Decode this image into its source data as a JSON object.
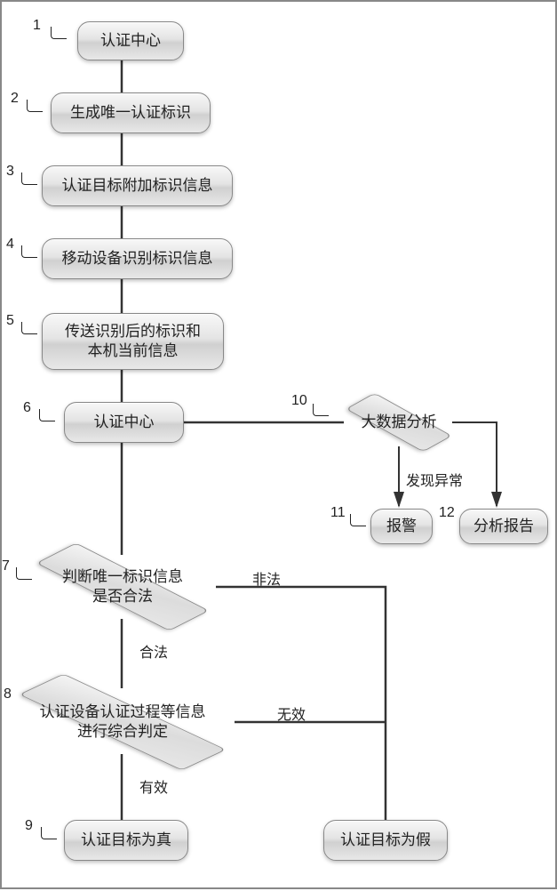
{
  "nodes": {
    "n1": "认证中心",
    "n2": "生成唯一认证标识",
    "n3": "认证目标附加标识信息",
    "n4": "移动设备识别标识信息",
    "n5": "传送识别后的标识和\n本机当前信息",
    "n6": "认证中心",
    "n7": "判断唯一标识信息\n是否合法",
    "n8": "认证设备认证过程等信息\n进行综合判定",
    "n9": "认证目标为真",
    "n10": "大数据分析",
    "n11": "报警",
    "n12": "分析报告",
    "nfalse": "认证目标为假"
  },
  "labels": {
    "l1": "1",
    "l2": "2",
    "l3": "3",
    "l4": "4",
    "l5": "5",
    "l6": "6",
    "l7": "7",
    "l8": "8",
    "l9": "9",
    "l10": "10",
    "l11": "11",
    "l12": "12"
  },
  "edge_labels": {
    "legal": "合法",
    "illegal": "非法",
    "valid": "有效",
    "invalid": "无效",
    "anomaly": "发现异常"
  },
  "chart_data": {
    "type": "flowchart",
    "nodes": [
      {
        "id": 1,
        "label": "认证中心",
        "shape": "rounded-rect"
      },
      {
        "id": 2,
        "label": "生成唯一认证标识",
        "shape": "rounded-rect"
      },
      {
        "id": 3,
        "label": "认证目标附加标识信息",
        "shape": "rounded-rect"
      },
      {
        "id": 4,
        "label": "移动设备识别标识信息",
        "shape": "rounded-rect"
      },
      {
        "id": 5,
        "label": "传送识别后的标识和本机当前信息",
        "shape": "rounded-rect"
      },
      {
        "id": 6,
        "label": "认证中心",
        "shape": "rounded-rect"
      },
      {
        "id": 7,
        "label": "判断唯一标识信息是否合法",
        "shape": "diamond"
      },
      {
        "id": 8,
        "label": "认证设备认证过程等信息进行综合判定",
        "shape": "diamond"
      },
      {
        "id": 9,
        "label": "认证目标为真",
        "shape": "rounded-rect"
      },
      {
        "id": 10,
        "label": "大数据分析",
        "shape": "diamond"
      },
      {
        "id": 11,
        "label": "报警",
        "shape": "rounded-rect"
      },
      {
        "id": 12,
        "label": "分析报告",
        "shape": "rounded-rect"
      },
      {
        "id": "false",
        "label": "认证目标为假",
        "shape": "rounded-rect"
      }
    ],
    "edges": [
      {
        "from": 1,
        "to": 2
      },
      {
        "from": 2,
        "to": 3
      },
      {
        "from": 3,
        "to": 4
      },
      {
        "from": 4,
        "to": 5
      },
      {
        "from": 5,
        "to": 6
      },
      {
        "from": 6,
        "to": 7
      },
      {
        "from": 6,
        "to": 10
      },
      {
        "from": 7,
        "to": 8,
        "label": "合法"
      },
      {
        "from": 7,
        "to": "false",
        "label": "非法"
      },
      {
        "from": 8,
        "to": 9,
        "label": "有效"
      },
      {
        "from": 8,
        "to": "false",
        "label": "无效"
      },
      {
        "from": 10,
        "to": 11,
        "label": "发现异常"
      },
      {
        "from": 10,
        "to": 12
      }
    ]
  }
}
